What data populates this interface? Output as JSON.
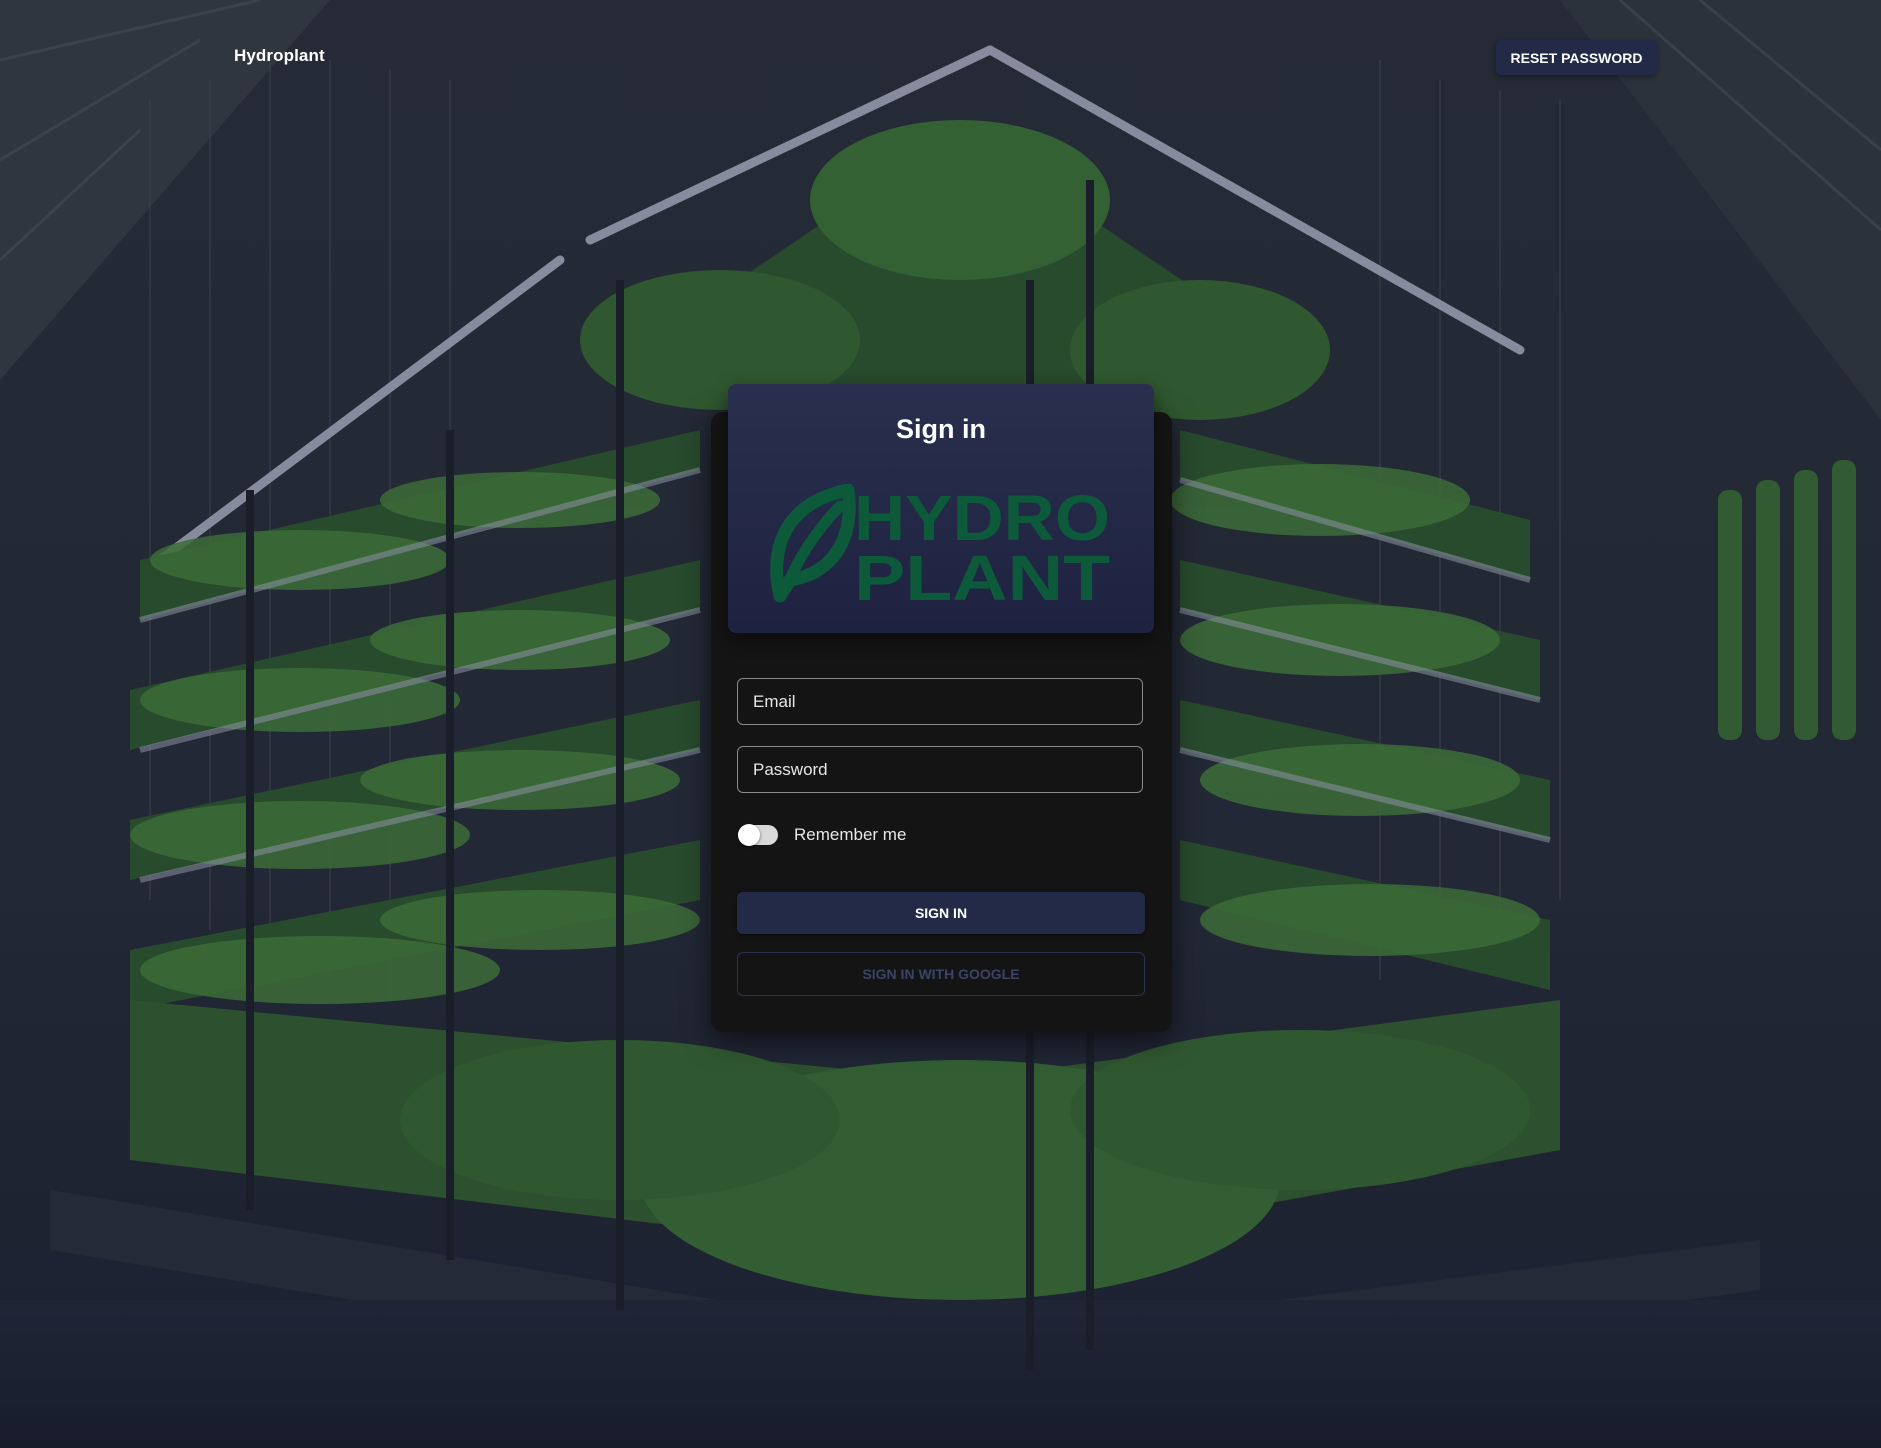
{
  "navbar": {
    "brand": "Hydroplant",
    "reset_password_label": "RESET PASSWORD"
  },
  "signin_card": {
    "title": "Sign in",
    "logo": {
      "line1": "HYDRO",
      "line2": "PLANT",
      "icon": "leaf-icon"
    },
    "email": {
      "placeholder": "Email",
      "value": ""
    },
    "password": {
      "placeholder": "Password",
      "value": ""
    },
    "remember_me": {
      "label": "Remember me",
      "checked": false
    },
    "signin_label": "SIGN IN",
    "google_label": "SIGN IN WITH GOOGLE"
  },
  "colors": {
    "primary": "#232a48",
    "card_bg": "#141414",
    "logo_green": "#0c5a3a",
    "text": "#ffffff"
  }
}
